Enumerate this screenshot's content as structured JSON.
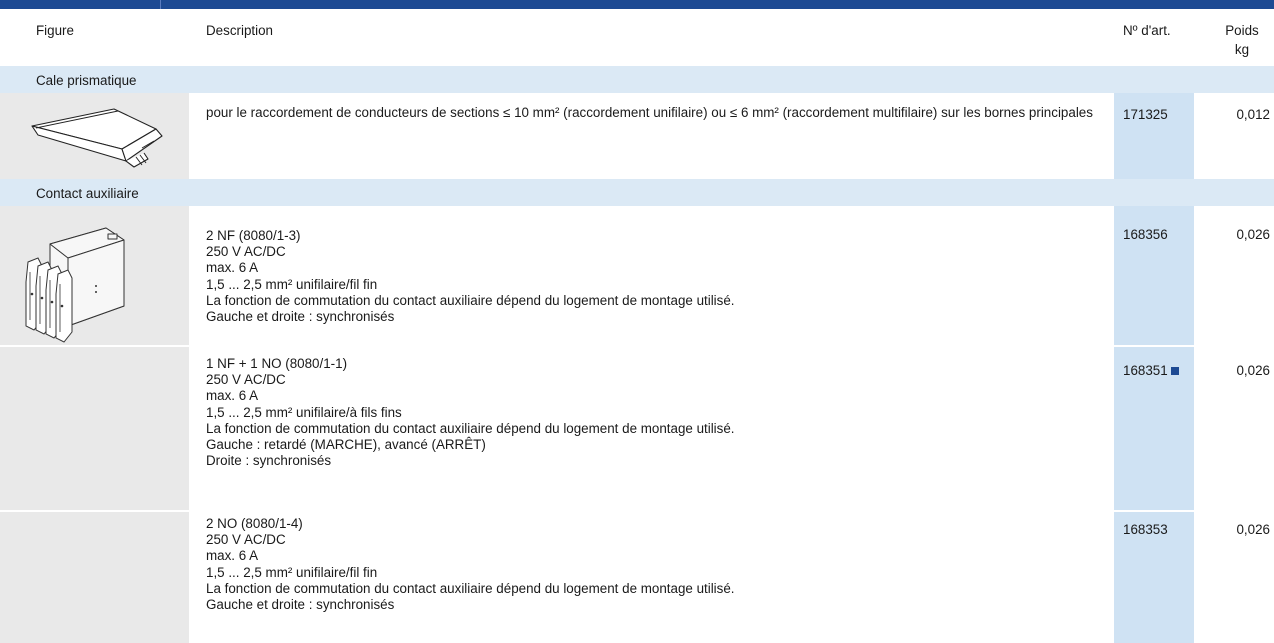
{
  "header": {
    "figure": "Figure",
    "description": "Description",
    "art_no": "Nº d'art.",
    "weight_line1": "Poids",
    "weight_line2": "kg"
  },
  "sections": [
    {
      "title": "Cale prismatique",
      "figure_icon": "prismatic-wedge-drawing",
      "rows": [
        {
          "description": "pour le raccordement de conducteurs de sections ≤ 10 mm² (raccordement unifilaire) ou ≤ 6 mm² (raccordement multifilaire) sur les bornes principales",
          "art": "171325",
          "weight": "0,012"
        }
      ]
    },
    {
      "title": "Contact auxiliaire",
      "figure_icon": "auxiliary-contact-drawing",
      "rows": [
        {
          "lines": [
            "2 NF (8080/1-3)",
            "250 V AC/DC",
            "max. 6 A",
            "1,5 ... 2,5 mm² unifilaire/fil fin",
            "La fonction de commutation du contact auxiliaire dépend du logement de montage utilisé.",
            "Gauche et droite : synchronisés"
          ],
          "art": "168356",
          "weight": "0,026"
        },
        {
          "lines": [
            "1 NF + 1 NO (8080/1-1)",
            "250 V AC/DC",
            "max. 6 A",
            "1,5 ... 2,5 mm² unifilaire/à fils fins",
            "La fonction de commutation du contact auxiliaire dépend du logement de montage utilisé.",
            "Gauche : retardé (MARCHE), avancé (ARRÊT)",
            "Droite : synchronisés"
          ],
          "art": "168351",
          "marker_icon": "blue-square-icon",
          "weight": "0,026"
        },
        {
          "lines": [
            "2 NO (8080/1-4)",
            "250 V AC/DC",
            "max. 6 A",
            "1,5 ... 2,5 mm² unifilaire/fil fin",
            "La fonction de commutation du contact auxiliaire dépend du logement de montage utilisé.",
            "Gauche et droite : synchronisés"
          ],
          "art": "168353",
          "weight": "0,026"
        }
      ]
    }
  ],
  "colors": {
    "brand_blue": "#1d4a93",
    "section_band": "#dbe9f5",
    "art_column": "#cfe2f3",
    "figure_cell": "#e9e9e9"
  }
}
